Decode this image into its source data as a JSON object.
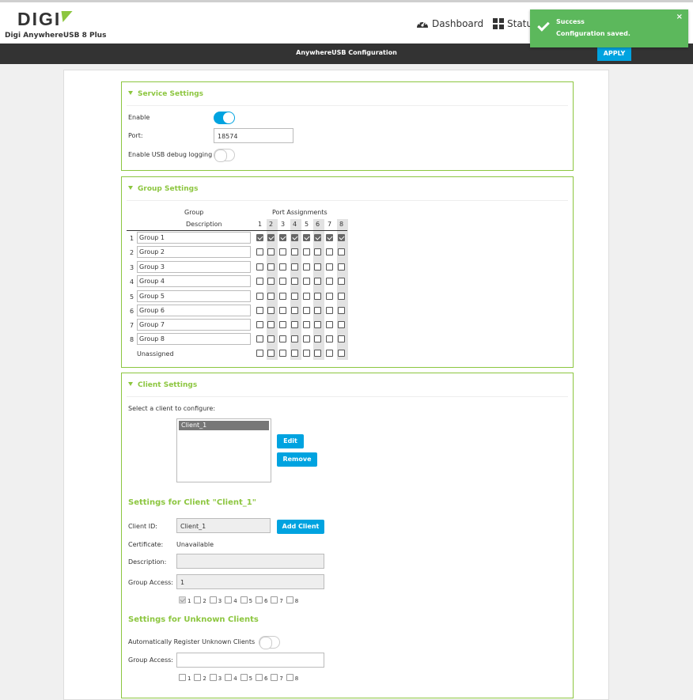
{
  "header": {
    "logo": "DIGI",
    "product": "Digi AnywhereUSB 8 Plus",
    "nav_dashboard": "Dashboard",
    "nav_status": "Status"
  },
  "subbar": {
    "title": "AnywhereUSB Configuration",
    "apply_label": "APPLY"
  },
  "toast": {
    "title": "Success",
    "message": "Configuration saved.",
    "close": "×"
  },
  "service": {
    "title": "Service Settings",
    "enable_label": "Enable",
    "enable_on": true,
    "port_label": "Port:",
    "port_value": "18574",
    "debug_label": "Enable USB debug logging",
    "debug_on": false
  },
  "groups": {
    "title": "Group Settings",
    "col_group": "Group",
    "col_desc": "Description",
    "col_ports": "Port Assignments",
    "ports": [
      "1",
      "2",
      "3",
      "4",
      "5",
      "6",
      "7",
      "8"
    ],
    "rows": [
      {
        "num": "1",
        "desc": "Group 1",
        "checked": [
          1,
          1,
          1,
          1,
          1,
          1,
          1,
          1
        ]
      },
      {
        "num": "2",
        "desc": "Group 2",
        "checked": [
          0,
          0,
          0,
          0,
          0,
          0,
          0,
          0
        ]
      },
      {
        "num": "3",
        "desc": "Group 3",
        "checked": [
          0,
          0,
          0,
          0,
          0,
          0,
          0,
          0
        ]
      },
      {
        "num": "4",
        "desc": "Group 4",
        "checked": [
          0,
          0,
          0,
          0,
          0,
          0,
          0,
          0
        ]
      },
      {
        "num": "5",
        "desc": "Group 5",
        "checked": [
          0,
          0,
          0,
          0,
          0,
          0,
          0,
          0
        ]
      },
      {
        "num": "6",
        "desc": "Group 6",
        "checked": [
          0,
          0,
          0,
          0,
          0,
          0,
          0,
          0
        ]
      },
      {
        "num": "7",
        "desc": "Group 7",
        "checked": [
          0,
          0,
          0,
          0,
          0,
          0,
          0,
          0
        ]
      },
      {
        "num": "8",
        "desc": "Group 8",
        "checked": [
          0,
          0,
          0,
          0,
          0,
          0,
          0,
          0
        ]
      }
    ],
    "unassigned_label": "Unassigned"
  },
  "clients": {
    "title": "Client Settings",
    "select_label": "Select a client to configure:",
    "list": [
      "Client_1"
    ],
    "edit_label": "Edit",
    "remove_label": "Remove",
    "settings_title": "Settings for Client \"Client_1\"",
    "client_id_label": "Client ID:",
    "client_id_value": "Client_1",
    "add_client_label": "Add Client",
    "certificate_label": "Certificate:",
    "certificate_value": "Unavailable",
    "description_label": "Description:",
    "description_value": "",
    "group_access_label": "Group Access:",
    "group_access_value": "1",
    "group_checks": [
      "1",
      "2",
      "3",
      "4",
      "5",
      "6",
      "7",
      "8"
    ],
    "group_checked": [
      1,
      0,
      0,
      0,
      0,
      0,
      0,
      0
    ],
    "unknown_title": "Settings for Unknown Clients",
    "auto_register_label": "Automatically Register Unknown Clients",
    "auto_register_on": false,
    "unknown_group_access_label": "Group Access:",
    "unknown_group_access_value": "",
    "unknown_group_checked": [
      0,
      0,
      0,
      0,
      0,
      0,
      0,
      0
    ]
  }
}
